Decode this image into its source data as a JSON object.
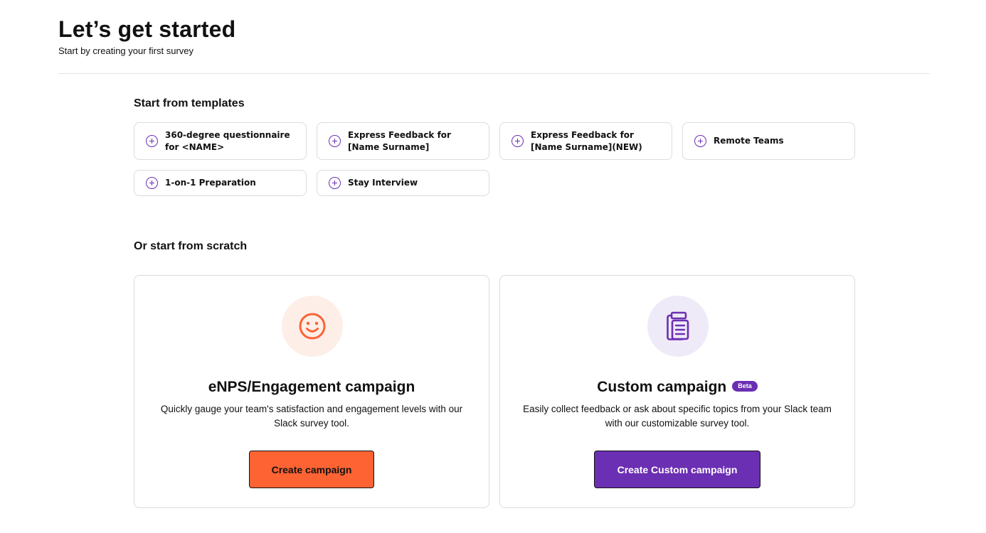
{
  "header": {
    "title": "Let’s get started",
    "subtitle": "Start by creating your first survey"
  },
  "templates": {
    "title": "Start from templates",
    "items": [
      {
        "label": "360-degree questionnaire for <NAME>",
        "icon": "plus-circle-icon"
      },
      {
        "label": "Express Feedback for [Name Surname]",
        "icon": "plus-circle-icon"
      },
      {
        "label": "Express Feedback for [Name Surname](NEW)",
        "icon": "plus-circle-icon"
      },
      {
        "label": "Remote Teams",
        "icon": "plus-circle-icon"
      },
      {
        "label": "1-on-1 Preparation",
        "icon": "plus-circle-icon"
      },
      {
        "label": "Stay Interview",
        "icon": "plus-circle-icon"
      }
    ]
  },
  "scratch": {
    "title": "Or start from scratch",
    "cards": [
      {
        "icon": "smiley-face-icon",
        "title": "eNPS/Engagement campaign",
        "description": "Quickly gauge your team's satisfaction and engagement levels with our Slack survey tool.",
        "button_label": "Create campaign",
        "accent": "#fd6333"
      },
      {
        "icon": "clipboard-list-icon",
        "title": "Custom campaign",
        "badge": "Beta",
        "description": "Easily collect feedback or ask about specific topics from your Slack team with our customizable survey tool.",
        "button_label": "Create Custom campaign",
        "accent": "#6b2fb3"
      }
    ]
  }
}
